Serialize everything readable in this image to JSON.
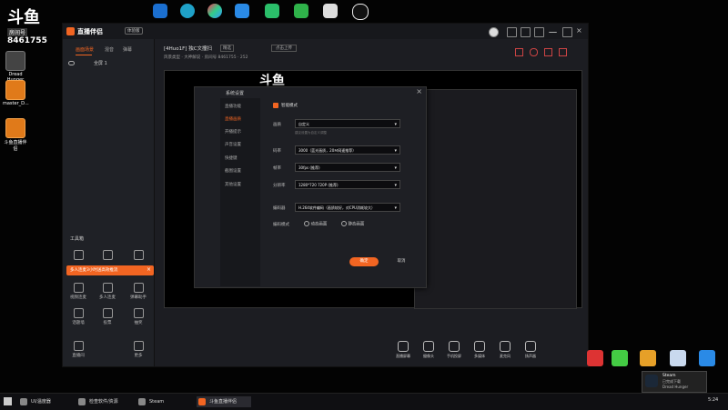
{
  "overlay": {
    "logo": "斗鱼",
    "caption": "房间号",
    "room_number": "8461755"
  },
  "desktop_icons": [
    {
      "label": "Dread Hunger"
    },
    {
      "label": "master_D..."
    },
    {
      "label": "斗鱼直播伴侣"
    }
  ],
  "app": {
    "name": "直播伴侣",
    "version_badge": "体验版",
    "left_tabs": [
      "画面场景",
      "混音",
      "弹幕"
    ],
    "scene_item": "全屏 1",
    "room_title": "[4Huo1F] 独C文撞扫",
    "room_tag": "精选",
    "room_action": "点击上传",
    "room_meta": "风景类型 · 大神解说 · 房间号 8461755 · 252",
    "tools_label": "工具箱",
    "promo_banner": "多人连麦3小时送高效推流",
    "tool_items": [
      "视频连麦",
      "多人连麦",
      "弹幕助手",
      "话题墙",
      "投票",
      "抽奖",
      "直播间",
      "更多"
    ],
    "bottom_tools": [
      "直播屏幕",
      "摄像头",
      "手机投屏",
      "多媒体",
      "麦克风",
      "扬声器"
    ],
    "settings_menu": [
      "直播功能",
      "直播画质",
      "开播提示",
      "声音设置",
      "快捷键",
      "截图设置",
      "其他设置"
    ]
  },
  "dialog": {
    "title": "系统设置",
    "checkbox_label": "智能模式",
    "checkbox_checked": true,
    "fields": [
      {
        "label": "画质",
        "value": "自定义"
      },
      {
        "label": "码率",
        "value": "3000（蓝光画质，20Ｍ网速推荐）"
      },
      {
        "label": "帧率",
        "value": "30fps (推荐)"
      },
      {
        "label": "分辨率",
        "value": "1280*720 720P (推荐)"
      },
      {
        "label": "编码器",
        "value": "H.264软件编码（画质较好，对CPU消耗较大）"
      }
    ],
    "hint": "建议设置为自定义调整",
    "encode_mode_label": "编码模式",
    "radio_options": [
      "动态画面",
      "静态画面"
    ],
    "confirm_label": "确定",
    "cancel_label": "取消"
  },
  "notification": {
    "title": "Steam",
    "line1": "已完成下载",
    "line2": "Dread Hunger"
  },
  "taskbar": {
    "apps": [
      "UI/温度器",
      "检查软件/资源",
      "Steam",
      "斗鱼直播伴侣"
    ],
    "time": "5:24"
  },
  "colors": {
    "accent_orange": "#f26522",
    "bg_dark": "#1c1d22"
  }
}
